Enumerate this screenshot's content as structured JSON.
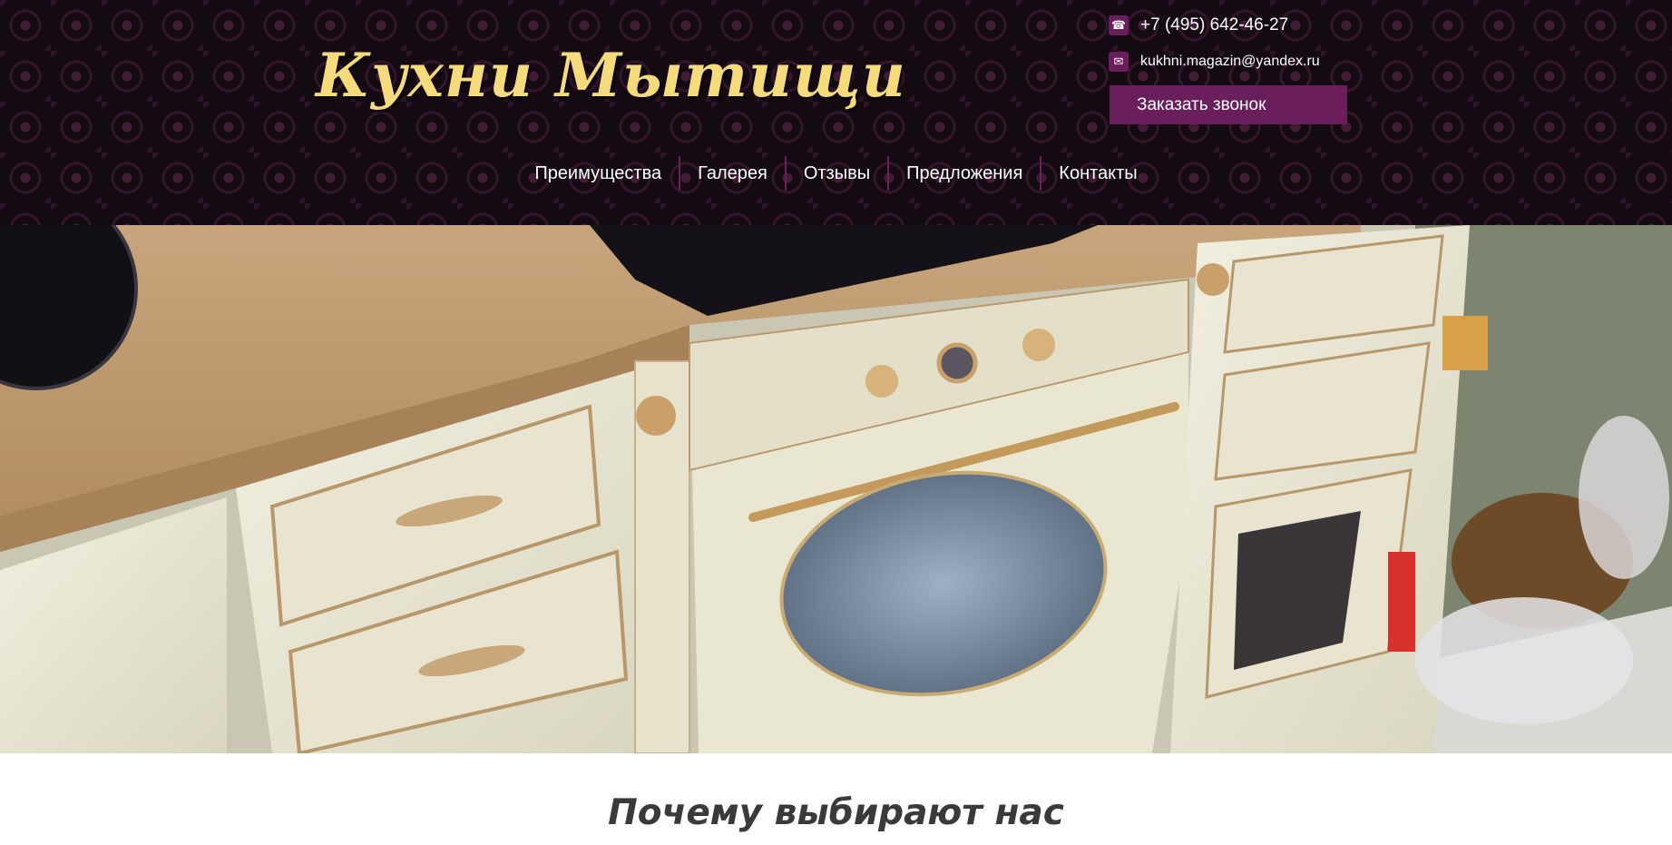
{
  "header": {
    "logo_text": "Кухни Мытищи",
    "phone": "+7 (495) 642-46-27",
    "email": "kukhni.magazin@yandex.ru",
    "callback_label": "Заказать звонок",
    "phone_icon": "phone-icon",
    "email_icon": "envelope-icon"
  },
  "nav": {
    "items": [
      "Преимущества",
      "Галерея",
      "Отзывы",
      "Предложения",
      "Контакты"
    ]
  },
  "hero": {
    "image": "kitchen-photo-cream-cabinets-oven"
  },
  "sections": {
    "why_title": "Почему выбирают нас"
  },
  "colors": {
    "accent": "#6a1f5c",
    "logo": "#f5db7c",
    "header_bg": "#140b12"
  }
}
